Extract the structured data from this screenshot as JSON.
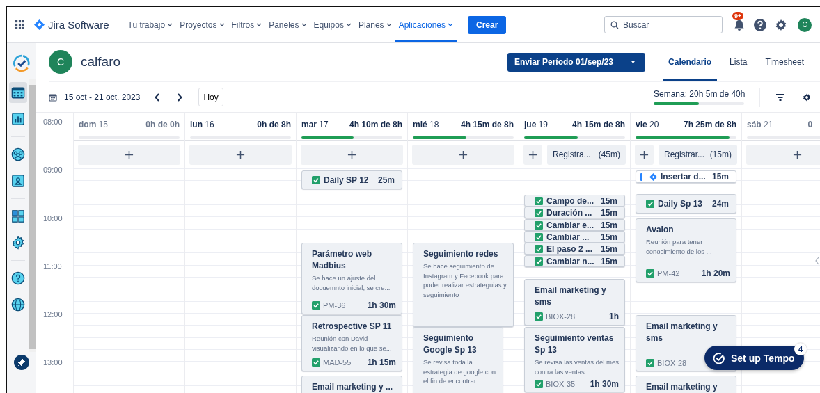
{
  "nav": {
    "brand": "Jira Software",
    "menu": [
      {
        "label": "Tu trabajo",
        "selected": false
      },
      {
        "label": "Proyectos",
        "selected": false
      },
      {
        "label": "Filtros",
        "selected": false
      },
      {
        "label": "Paneles",
        "selected": false
      },
      {
        "label": "Equipos",
        "selected": false
      },
      {
        "label": "Planes",
        "selected": false
      },
      {
        "label": "Aplicaciones",
        "selected": true
      }
    ],
    "create": "Crear",
    "search": {
      "placeholder": "Buscar"
    },
    "notifications_badge": "9+",
    "avatar": "C"
  },
  "sidebar": {
    "groups": [
      {
        "items": [
          {
            "kind": "calendar",
            "selected": true
          },
          {
            "kind": "chart",
            "selected": false
          }
        ]
      },
      {
        "items": [
          {
            "kind": "people",
            "selected": false
          },
          {
            "kind": "profile",
            "selected": false
          }
        ]
      },
      {
        "items": [
          {
            "kind": "apps",
            "selected": false
          },
          {
            "kind": "settings",
            "selected": false
          }
        ]
      },
      {
        "items": [
          {
            "kind": "help",
            "selected": false
          },
          {
            "kind": "globe",
            "selected": false
          }
        ]
      }
    ]
  },
  "user": {
    "avatar": "C",
    "name": "calfaro"
  },
  "submit": {
    "label": "Enviar Período 01/sep/23"
  },
  "view_tabs": [
    {
      "label": "Calendario",
      "selected": true
    },
    {
      "label": "Lista",
      "selected": false
    },
    {
      "label": "Timesheet",
      "selected": false
    }
  ],
  "toolbar": {
    "range": "15 oct - 21 oct. 2023",
    "today": "Hoy",
    "week_total": "Semana: 20h 5m de 40h",
    "level": 0.5
  },
  "times": [
    "08:00",
    "09:00",
    "10:00",
    "11:00",
    "12:00",
    "13:00"
  ],
  "days": [
    {
      "name": "dom",
      "date": "15",
      "hours": "0h de 0h",
      "weekend": true,
      "level": 0
    },
    {
      "name": "lun",
      "date": "16",
      "hours": "0h de 8h",
      "weekend": false,
      "level": 0
    },
    {
      "name": "mar",
      "date": "17",
      "hours": "4h 10m de 8h",
      "weekend": false,
      "level": 0.52,
      "events": [
        {
          "kind": "compact",
          "title": "Daily SP 12",
          "duration": "25m"
        },
        {
          "kind": "card",
          "title": "Parámetro web Madbius",
          "description": "Se hace un ajuste del docuemnto inicial, se cre...",
          "key": "PM-36",
          "duration": "1h 30m"
        },
        {
          "kind": "card",
          "title": "Retrospective SP 11",
          "description": "Reunión con David visualizando en lo que se...",
          "key": "MAD-55",
          "duration": "1h 15m"
        },
        {
          "kind": "card",
          "title": "Email marketing y ..."
        }
      ]
    },
    {
      "name": "mié",
      "date": "18",
      "hours": "4h 15m de 8h",
      "weekend": false,
      "level": 0.53,
      "events": [
        {
          "kind": "card",
          "title": "Seguimiento redes",
          "description": "Se hace seguimiento de Instagram y Facebook para poder realizar estrateguias y seguimiento"
        },
        {
          "kind": "card",
          "title": "Seguimiento Google Sp 13",
          "description": "Se revisa toda la estrategia de google con el fin de encontrar"
        }
      ]
    },
    {
      "name": "jue",
      "date": "19",
      "hours": "4h 15m de 8h",
      "weekend": false,
      "level": 0.53,
      "log": {
        "label": "Registra...",
        "amount": "(45m)"
      },
      "events": [
        {
          "kind": "compact",
          "title": "Campo de...",
          "duration": "15m"
        },
        {
          "kind": "compact",
          "title": "Duración ...",
          "duration": "15m"
        },
        {
          "kind": "compact",
          "title": "Cambiar e...",
          "duration": "15m"
        },
        {
          "kind": "compact",
          "title": "Cambiar ...",
          "duration": "15m"
        },
        {
          "kind": "compact",
          "title": "El paso 2 ...",
          "duration": "15m"
        },
        {
          "kind": "compact",
          "title": "Cambiar n...",
          "duration": "15m"
        },
        {
          "kind": "card",
          "title": "Email marketing y sms",
          "key": "BIOX-28",
          "duration": "1h"
        },
        {
          "kind": "card",
          "title": "Seguimiento ventas Sp 13",
          "description": "Se revisa las ventas del mes contra las ventas ...",
          "key": "BIOX-35",
          "duration": "1h 30m"
        }
      ]
    },
    {
      "name": "vie",
      "date": "20",
      "hours": "7h 25m de 8h",
      "weekend": false,
      "level": 0.93,
      "log": {
        "label": "Registrar...",
        "amount": "(15m)"
      },
      "events": [
        {
          "kind": "jira",
          "title": "Insertar d...",
          "duration": "15m"
        },
        {
          "kind": "compact",
          "title": "Daily Sp 13",
          "duration": "24m"
        },
        {
          "kind": "card",
          "title": "Avalon",
          "description": "Reunión para tener conocimiento de los ...",
          "key": "PM-42",
          "duration": "1h 20m"
        },
        {
          "kind": "card",
          "title": "Email marketing y sms",
          "key": "BIOX-28"
        },
        {
          "kind": "card",
          "title": "Email marketing y"
        }
      ]
    },
    {
      "name": "sáb",
      "date": "21",
      "hours": "0",
      "weekend": true,
      "level": 0
    }
  ],
  "tempo": {
    "label": "Set up Tempo",
    "badge": "4"
  }
}
